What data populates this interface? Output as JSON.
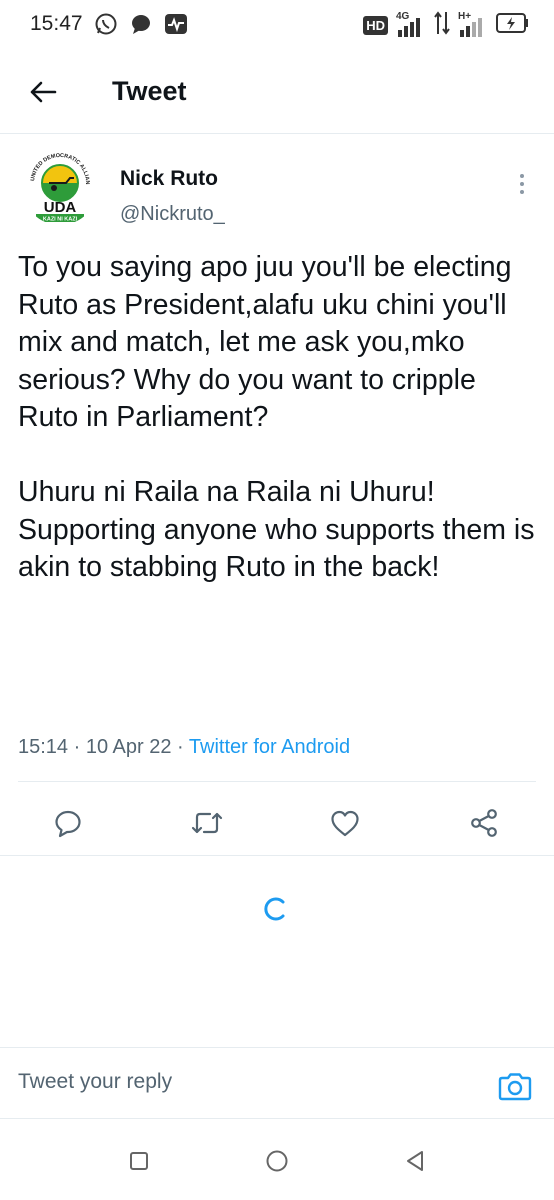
{
  "status_bar": {
    "time": "15:47",
    "left_icons": [
      "whatsapp-icon",
      "chat-bubble-icon",
      "activity-icon"
    ],
    "right_icons": [
      "hd-icon",
      "signal-4g-icon",
      "data-arrows-icon",
      "signal-hplus-icon",
      "battery-charging-icon"
    ],
    "hd_label": "HD",
    "network_4g": "4G",
    "network_hplus": "H+"
  },
  "header": {
    "title": "Tweet",
    "back_icon": "arrow-left-icon"
  },
  "tweet": {
    "author_name": "Nick Ruto",
    "author_handle": "@Nickruto_",
    "avatar": {
      "logo_text": "UDA",
      "ring_text": "UNITED DEMOCRATIC ALLIANCE",
      "motto": "KAZI NI KAZI"
    },
    "text": "To you saying apo juu you'll be electing Ruto as President,alafu uku chini you'll mix and match, let me ask you,mko serious? Why do you want to cripple Ruto in Parliament?\n\nUhuru ni Raila na Raila ni Uhuru! Supporting anyone who supports them is akin to stabbing Ruto in the back!",
    "time": "15:14",
    "separator": "·",
    "date": "10 Apr 22",
    "source": "Twitter for Android",
    "actions": [
      "reply-icon",
      "retweet-icon",
      "like-icon",
      "share-icon"
    ]
  },
  "reply": {
    "placeholder": "Tweet your reply"
  },
  "colors": {
    "accent": "#1d9bf0",
    "text_primary": "#0f1419",
    "text_secondary": "#536471",
    "divider": "#e6ecf0"
  }
}
